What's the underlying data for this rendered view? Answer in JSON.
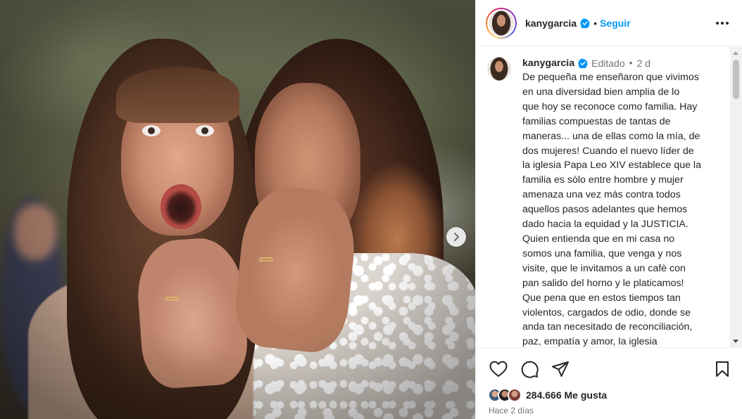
{
  "header": {
    "username": "kanygarcia",
    "separator": "•",
    "follow_label": "Seguir",
    "more_icon": "more-horizontal-icon"
  },
  "caption": {
    "username": "kanygarcia",
    "edited_label": "Editado",
    "separator": "•",
    "time": "2 d",
    "text": "De pequeña me enseñaron que vivimos\nen una diversidad bien amplia de lo\nque hoy se reconoce como familia. Hay\nfamilias compuestas de tantas de\nmaneras... una de ellas como la mía, de\ndos mujeres! Cuando el nuevo líder de\nla iglesia Papa Leo XIV establece que la\nfamilia es sòlo entre hombre y mujer\namenaza una vez más contra todos\naquellos pasos adelantes que hemos\ndado hacia la equidad y la JUSTICIA.\nQuien entienda que en mi casa no\nsomos una familia, que venga y nos\nvisite, que le invitamos a un cafè con\npan salido del horno y le platicamos!\nQue pena que en estos tiempos tan\nviolentos, cargados de odio, donde se\nanda tan necesitado de reconciliación,\npaz, empatía y amor, la iglesia\nno opte por dividir a todos"
  },
  "actions": {
    "icons": [
      "heart-icon",
      "comment-icon",
      "share-icon",
      "bookmark-icon"
    ]
  },
  "likes": {
    "count_label": "284.666 Me gusta"
  },
  "time_ago": "Hace 2 días",
  "colors": {
    "follow": "#0095f6",
    "verified": "#0095f6",
    "text": "#262626",
    "muted": "#737373"
  }
}
